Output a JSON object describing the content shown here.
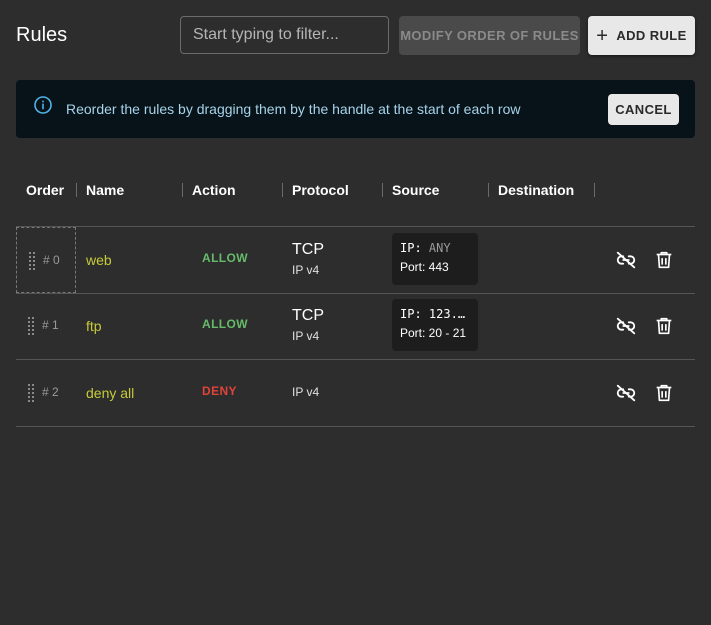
{
  "header": {
    "title": "Rules",
    "filter_placeholder": "Start typing to filter...",
    "modify_order_label": "MODIFY ORDER OF RULES",
    "add_rule_label": "ADD RULE"
  },
  "alert": {
    "message": "Reorder the rules by dragging them by the handle at the start of each row",
    "cancel_label": "CANCEL"
  },
  "table": {
    "columns": [
      "Order",
      "Name",
      "Action",
      "Protocol",
      "Source",
      "Destination"
    ],
    "rows": [
      {
        "order": "# 0",
        "name": "web",
        "action": "ALLOW",
        "action_color": "#66bb6a",
        "protocol": "TCP",
        "ip_version": "IP v4",
        "source_ip_label": "IP:",
        "source_ip": "ANY",
        "source_port": "Port: 443"
      },
      {
        "order": "# 1",
        "name": "ftp",
        "action": "ALLOW",
        "action_color": "#66bb6a",
        "protocol": "TCP",
        "ip_version": "IP v4",
        "source_ip_label": "IP:",
        "source_ip": "123.…",
        "source_port": "Port: 20 - 21"
      },
      {
        "order": "# 2",
        "name": "deny all",
        "action": "DENY",
        "action_color": "#e0433a",
        "protocol": "",
        "ip_version": "IP v4"
      }
    ]
  },
  "colors": {
    "background": "#2d2d2d",
    "name_text": "#c6cb39",
    "allow": "#66bb6a",
    "deny": "#e0433a",
    "alert_bg": "#071318",
    "alert_text": "#a7d3ea"
  },
  "icons": {
    "info": "info-icon",
    "plus": "plus-icon",
    "handle": "drag-handle-icon",
    "unlink": "link-off-icon",
    "delete": "trash-icon"
  }
}
